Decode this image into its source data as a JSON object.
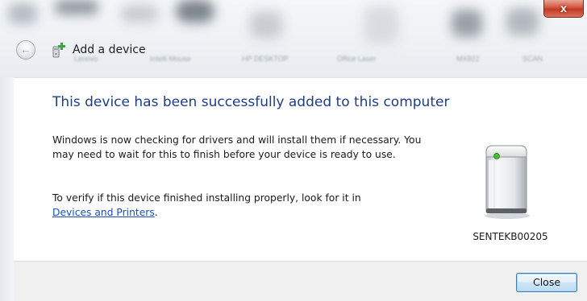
{
  "window": {
    "title": "Add a device",
    "close_glyph": "x",
    "back_glyph": "←"
  },
  "backdrop": {
    "labels": [
      "Lenovo",
      "Intelli Mouse",
      "HP DESKTOP",
      "Office Laser",
      "MX822",
      "SCAN"
    ]
  },
  "content": {
    "heading": "This device has been successfully added to this computer",
    "paragraph1": "Windows is now checking for drivers and will install them if necessary. You may need to wait for this to finish before your device is ready to use.",
    "paragraph2_prefix": "To verify if this device finished installing properly, look for it in",
    "paragraph2_link": "Devices and Printers",
    "paragraph2_suffix": "."
  },
  "device": {
    "name": "SENTEKB00205",
    "icon": "external-drive-icon",
    "led_color": "#3fbf2a"
  },
  "footer": {
    "close_label": "Close"
  },
  "colors": {
    "heading": "#1e3c8c",
    "link": "#1a4fb5",
    "close_button_border": "#3c7fb1",
    "window_close": "#c23a24"
  }
}
